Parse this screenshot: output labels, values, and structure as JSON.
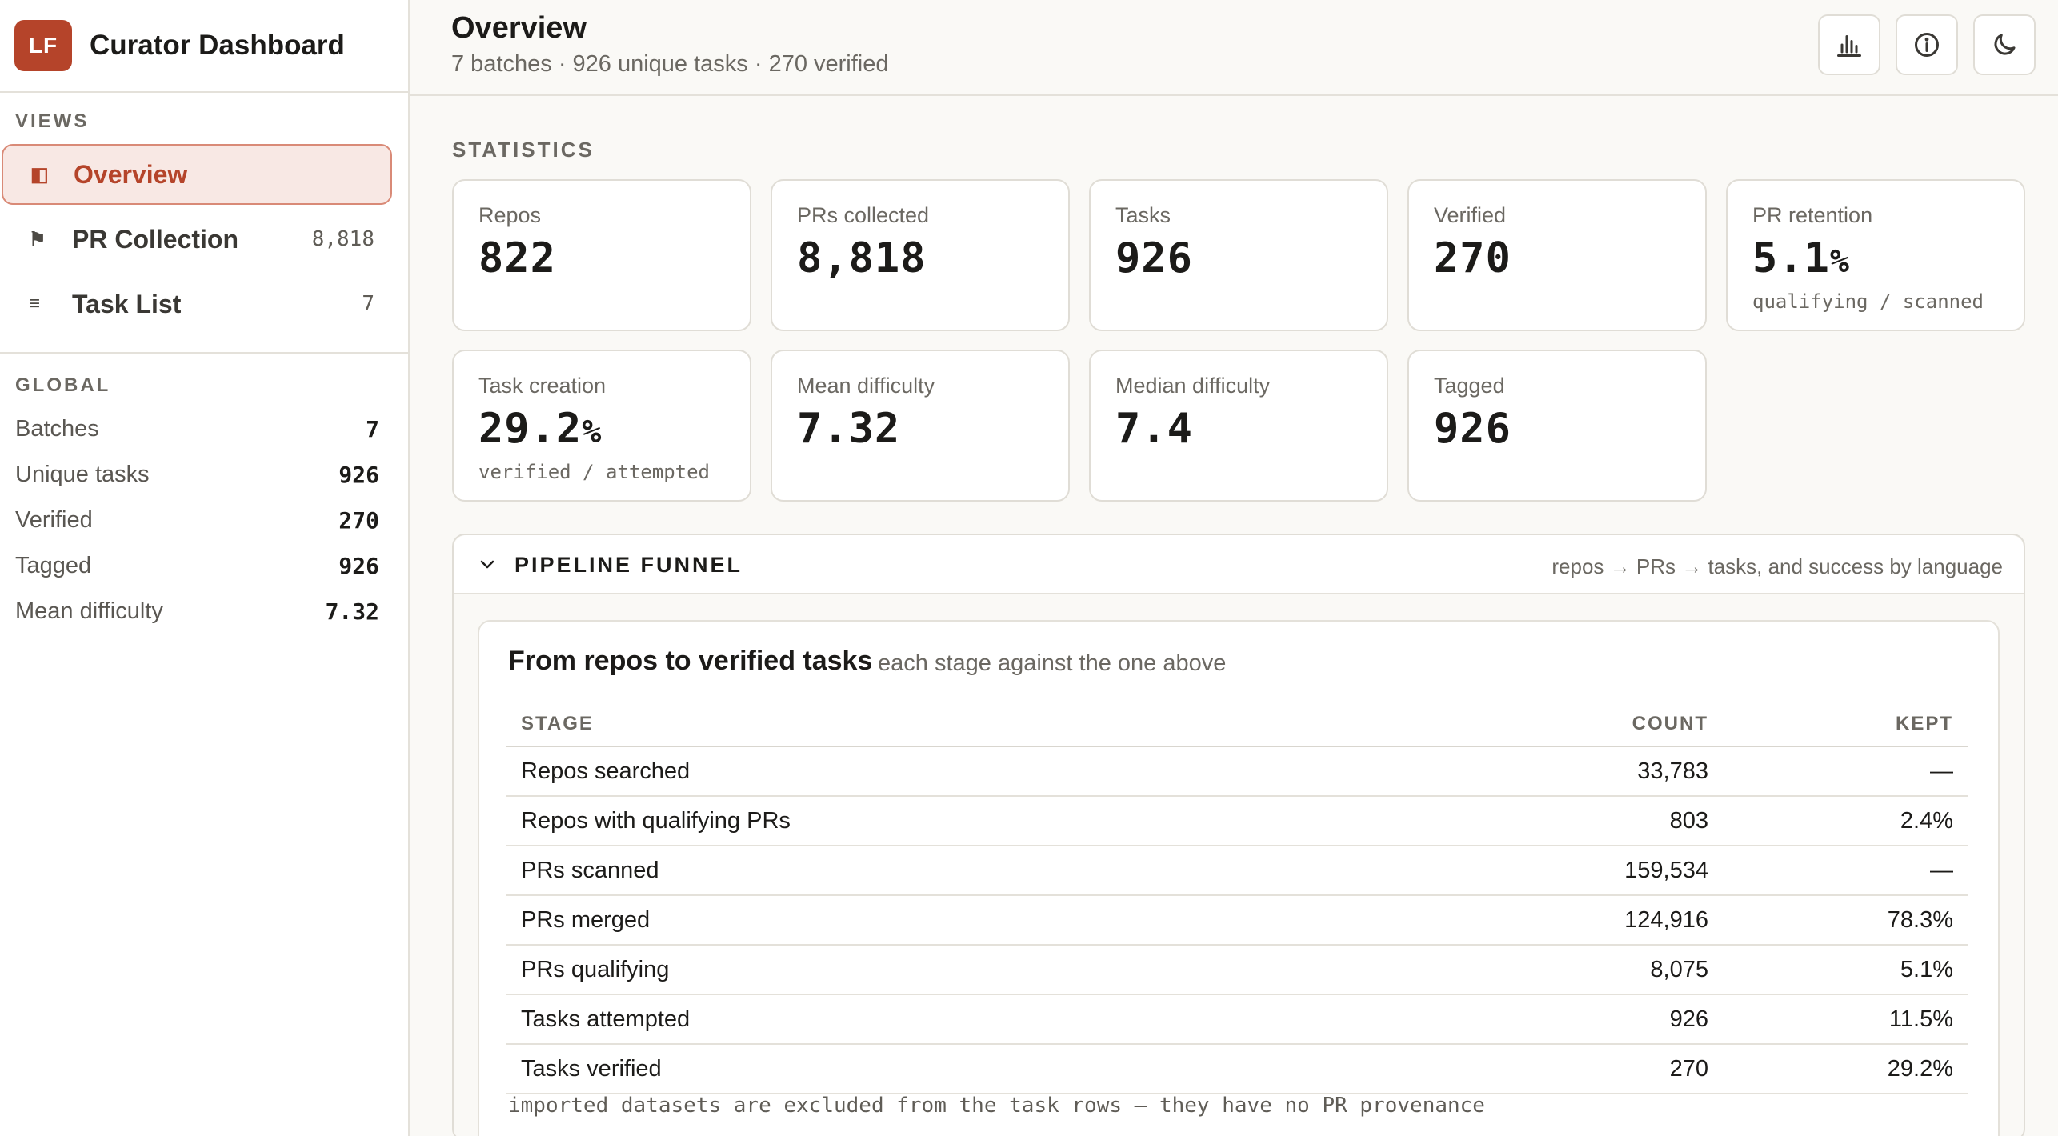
{
  "app": {
    "logo_text": "LF",
    "title": "Curator Dashboard",
    "accent": "#b5442a"
  },
  "sidebar": {
    "views_label": "VIEWS",
    "views": [
      {
        "label": "Overview",
        "icon": "sidebar-panel-icon",
        "count": "",
        "active": true
      },
      {
        "label": "PR Collection",
        "icon": "flag-icon",
        "count": "8,818",
        "active": false
      },
      {
        "label": "Task List",
        "icon": "list-icon",
        "count": "7",
        "active": false
      }
    ],
    "global_label": "GLOBAL",
    "global": [
      {
        "label": "Batches",
        "value": "7"
      },
      {
        "label": "Unique tasks",
        "value": "926"
      },
      {
        "label": "Verified",
        "value": "270"
      },
      {
        "label": "Tagged",
        "value": "926"
      },
      {
        "label": "Mean difficulty",
        "value": "7.32"
      }
    ]
  },
  "header": {
    "title": "Overview",
    "subtitle": "7 batches · 926 unique tasks · 270 verified",
    "buttons": [
      "bar-chart-icon",
      "info-icon",
      "moon-icon"
    ]
  },
  "statistics": {
    "label": "STATISTICS",
    "cards": [
      {
        "label": "Repos",
        "value": "822",
        "unit": "",
        "sub": ""
      },
      {
        "label": "PRs collected",
        "value": "8,818",
        "unit": "",
        "sub": ""
      },
      {
        "label": "Tasks",
        "value": "926",
        "unit": "",
        "sub": ""
      },
      {
        "label": "Verified",
        "value": "270",
        "unit": "",
        "sub": ""
      },
      {
        "label": "PR retention",
        "value": "5.1",
        "unit": "%",
        "sub": "qualifying / scanned"
      },
      {
        "label": "Task creation",
        "value": "29.2",
        "unit": "%",
        "sub": "verified / attempted"
      },
      {
        "label": "Mean difficulty",
        "value": "7.32",
        "unit": "",
        "sub": ""
      },
      {
        "label": "Median difficulty",
        "value": "7.4",
        "unit": "",
        "sub": ""
      },
      {
        "label": "Tagged",
        "value": "926",
        "unit": "",
        "sub": ""
      }
    ]
  },
  "funnel": {
    "section_title": "PIPELINE FUNNEL",
    "section_hint": "repos → PRs → tasks, and success by language",
    "title": "From repos to verified tasks",
    "subtitle": "each stage against the one above",
    "columns": [
      "STAGE",
      "COUNT",
      "KEPT"
    ],
    "rows": [
      {
        "stage": "Repos searched",
        "count": "33,783",
        "kept": "—"
      },
      {
        "stage": "Repos with qualifying PRs",
        "count": "803",
        "kept": "2.4%"
      },
      {
        "stage": "PRs scanned",
        "count": "159,534",
        "kept": "—"
      },
      {
        "stage": "PRs merged",
        "count": "124,916",
        "kept": "78.3%"
      },
      {
        "stage": "PRs qualifying",
        "count": "8,075",
        "kept": "5.1%"
      },
      {
        "stage": "Tasks attempted",
        "count": "926",
        "kept": "11.5%"
      },
      {
        "stage": "Tasks verified",
        "count": "270",
        "kept": "29.2%"
      }
    ],
    "footnote": "imported datasets are excluded from the task rows — they have no PR provenance"
  }
}
